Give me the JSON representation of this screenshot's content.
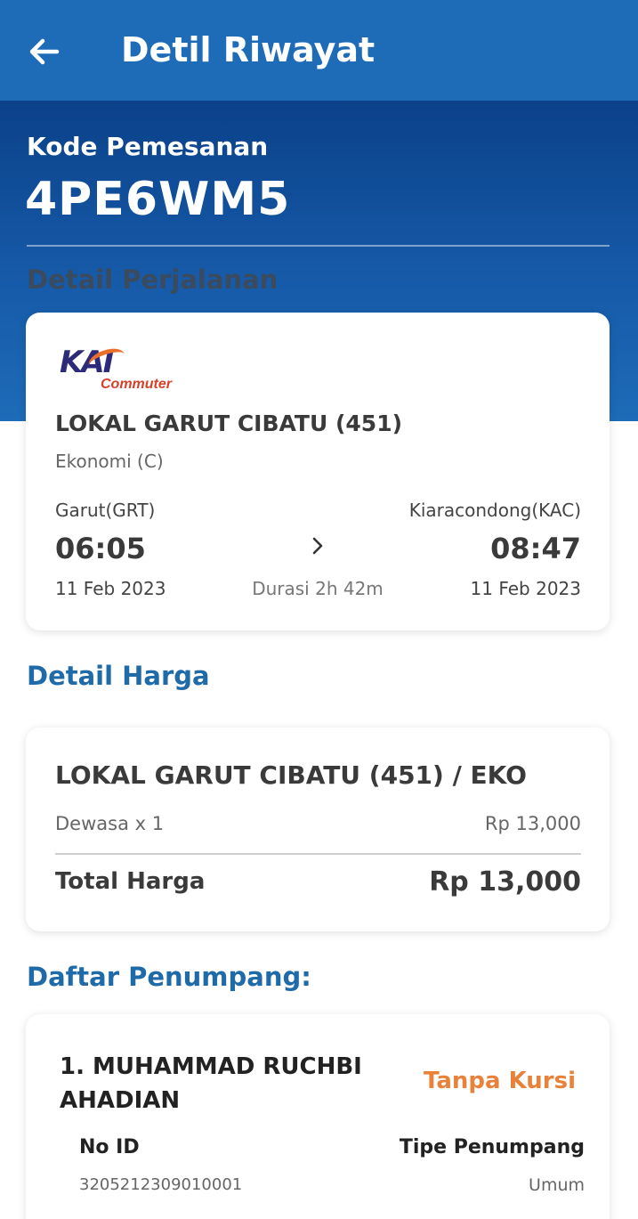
{
  "appbar": {
    "title": "Detil Riwayat"
  },
  "booking": {
    "label": "Kode Pemesanan",
    "code": "4PE6WM5"
  },
  "trip": {
    "section_title": "Detail Perjalanan",
    "logo": {
      "brand": "KAI",
      "sub": "Commuter"
    },
    "train_name": "LOKAL GARUT CIBATU (451)",
    "class": "Ekonomi (C)",
    "origin": {
      "station": "Garut(GRT)",
      "time": "06:05",
      "date": "11 Feb 2023"
    },
    "destination": {
      "station": "Kiaracondong(KAC)",
      "time": "08:47",
      "date": "11 Feb 2023"
    },
    "duration": "Durasi 2h 42m"
  },
  "price": {
    "section_title": "Detail Harga",
    "fare_name": "LOKAL GARUT CIBATU (451) / EKO",
    "line_label": "Dewasa x 1",
    "line_value": "Rp 13,000",
    "total_label": "Total Harga",
    "total_value": "Rp 13,000"
  },
  "passengers": {
    "section_title": "Daftar Penumpang:",
    "items": [
      {
        "name": "1. MUHAMMAD RUCHBI AHADIAN",
        "seat_status": "Tanpa Kursi",
        "id_label": "No ID",
        "id_value": "3205212309010001",
        "type_label": "Tipe Penumpang",
        "type_value": "Umum"
      }
    ]
  },
  "colors": {
    "appbar": "#1e6bb8",
    "accent_title": "#1f6aa8",
    "seat_status": "#e8823a"
  },
  "icons": {
    "back": "arrow-left-icon",
    "chevron": "chevron-right-icon"
  }
}
